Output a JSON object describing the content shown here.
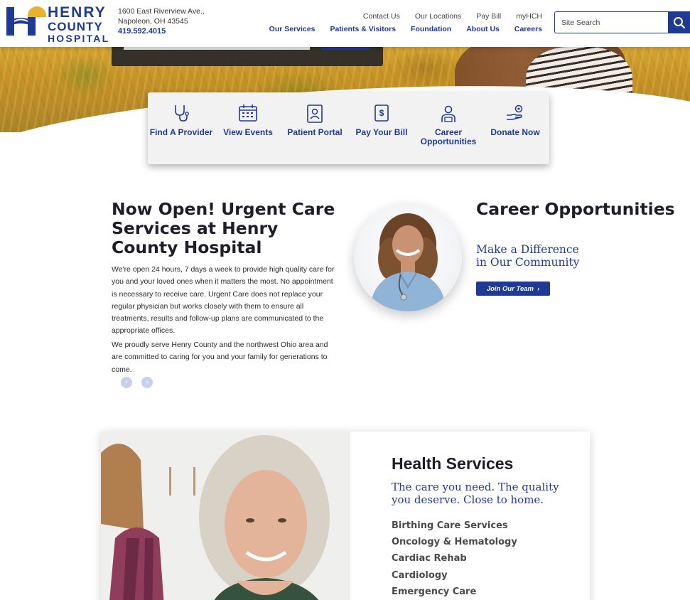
{
  "header": {
    "logo": {
      "line1": "HENRY",
      "line2": "COUNTY",
      "line3": "HOSPITAL"
    },
    "address": {
      "line1": "1600 East Riverview Ave.,",
      "line2": "Napoleon, OH 43545",
      "phone": "419.592.4015"
    },
    "utility_nav": [
      "Contact Us",
      "Our Locations",
      "Pay Bill",
      "myHCH"
    ],
    "main_nav": [
      "Our Services",
      "Patients & Visitors",
      "Foundation",
      "About Us",
      "Careers"
    ],
    "search": {
      "placeholder": "Site Search"
    }
  },
  "quick_links": [
    {
      "label": "Find A Provider",
      "icon": "stethoscope-icon"
    },
    {
      "label": "View Events",
      "icon": "calendar-icon"
    },
    {
      "label": "Patient Portal",
      "icon": "portal-icon"
    },
    {
      "label": "Pay Your Bill",
      "icon": "bill-icon"
    },
    {
      "label": "Career Opportunities",
      "icon": "career-icon"
    },
    {
      "label": "Donate Now",
      "icon": "donate-icon"
    }
  ],
  "urgent": {
    "title": "Now Open! Urgent Care Services at Henry County Hospital",
    "para1": "We're open 24 hours, 7 days a week to provide high quality care for you and your loved ones when it matters the most. No appointment is necessary to receive care. Urgent Care does not replace your regular physician but works closely with them to ensure all treatments, results and follow-up plans are communicated to the appropriate offices.",
    "para2": "We proudly serve Henry County and the northwest Ohio area and are committed to caring for you and your family for generations to come."
  },
  "career": {
    "title": "Career Opportunities",
    "subtitle": "Make a Difference in Our Community",
    "button": "Join Our Team"
  },
  "health_services": {
    "title": "Health Services",
    "subtitle": "The care you need. The quality you deserve. Close to home.",
    "items": [
      "Birthing Care Services",
      "Oncology & Hematology",
      "Cardiac Rehab",
      "Cardiology",
      "Emergency Care"
    ]
  },
  "colors": {
    "brand_blue": "#1f3a93",
    "logo_gold": "#e8b32a"
  }
}
